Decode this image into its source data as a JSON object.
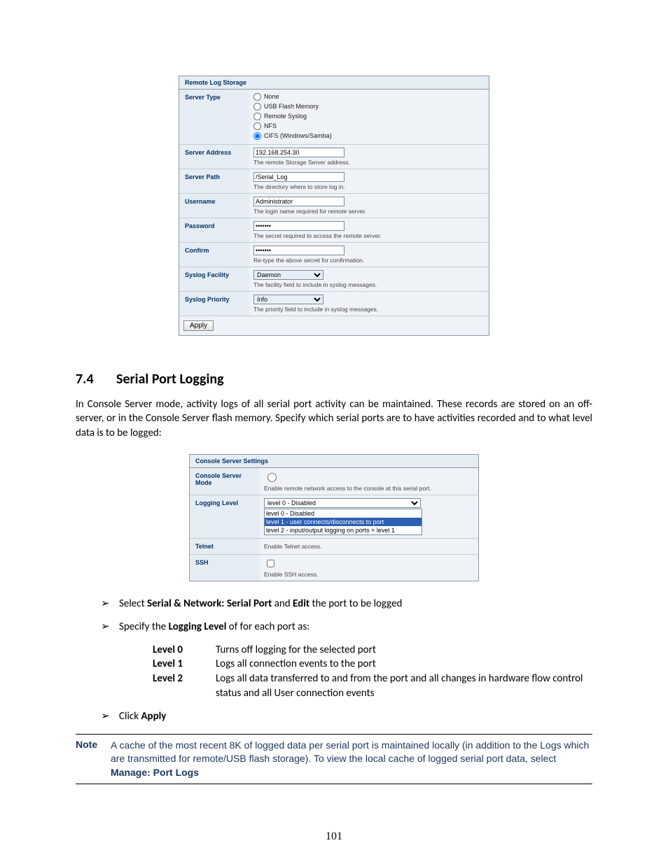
{
  "panel1": {
    "title": "Remote Log Storage",
    "serverType": {
      "label": "Server Type",
      "options": [
        "None",
        "USB Flash Memory",
        "Remote Syslog",
        "NFS",
        "CIFS (Windows/Samba)"
      ],
      "selected": 4
    },
    "serverAddress": {
      "label": "Server Address",
      "value": "192.168.254.30",
      "help": "The remote Storage Server address."
    },
    "serverPath": {
      "label": "Server Path",
      "value": "/Serial_Log",
      "help": "The directory where to store log in."
    },
    "username": {
      "label": "Username",
      "value": "Administrator",
      "help": "The login name required for remote server."
    },
    "password": {
      "label": "Password",
      "value": "•••••••",
      "help": "The secret required to access the remote server."
    },
    "confirm": {
      "label": "Confirm",
      "value": "•••••••",
      "help": "Re-type the above secret for confirmation."
    },
    "syslogFacility": {
      "label": "Syslog Facility",
      "value": "Daemon",
      "help": "The facility field to include in syslog messages."
    },
    "syslogPriority": {
      "label": "Syslog Priority",
      "value": "Info",
      "help": "The priority field to include in syslog messages."
    },
    "apply": "Apply"
  },
  "section": {
    "number": "7.4",
    "title": "Serial Port Logging"
  },
  "intro": "In Console Server mode, activity logs of all serial port activity can be maintained. These records are stored on an off-server, or in the Console Server flash memory. Specify which serial ports are to have activities recorded and to what level data is to be logged:",
  "panel2": {
    "title": "Console Server Settings",
    "mode": {
      "label": "Console Server Mode",
      "help": "Enable remote network access to the console at this serial port."
    },
    "logging": {
      "label": "Logging Level",
      "selected": "level 0 - Disabled",
      "opts": [
        "level 0 - Disabled",
        "level 1 - user connects/disconnects to port",
        "level 2 - input/output logging on ports + level 1"
      ]
    },
    "telnet": {
      "label": "Telnet",
      "help": "Enable Telnet access."
    },
    "ssh": {
      "label": "SSH",
      "help": "Enable SSH access."
    }
  },
  "bullets": {
    "b1a": "Select ",
    "b1b": "Serial & Network: Serial Port",
    "b1c": " and ",
    "b1d": "Edit",
    "b1e": " the port to be logged",
    "b2a": "Specify the ",
    "b2b": "Logging Level",
    "b2c": " of for each port as:",
    "b3a": "Click ",
    "b3b": "Apply"
  },
  "levels": [
    {
      "name": "Level 0",
      "desc": "Turns off logging for the selected port"
    },
    {
      "name": "Level 1",
      "desc": "Logs all connection events to the port"
    },
    {
      "name": "Level 2",
      "desc": "Logs all data transferred to and from the port and all changes in hardware flow control status and all User connection events"
    }
  ],
  "note": {
    "label": "Note",
    "text1": "A cache of the most recent 8K of logged data per serial port is maintained locally (in addition to the Logs which are transmitted for remote/USB flash storage). To view the local cache of logged serial port data, select ",
    "text2": "Manage: Port Logs"
  },
  "pageNumber": "101"
}
